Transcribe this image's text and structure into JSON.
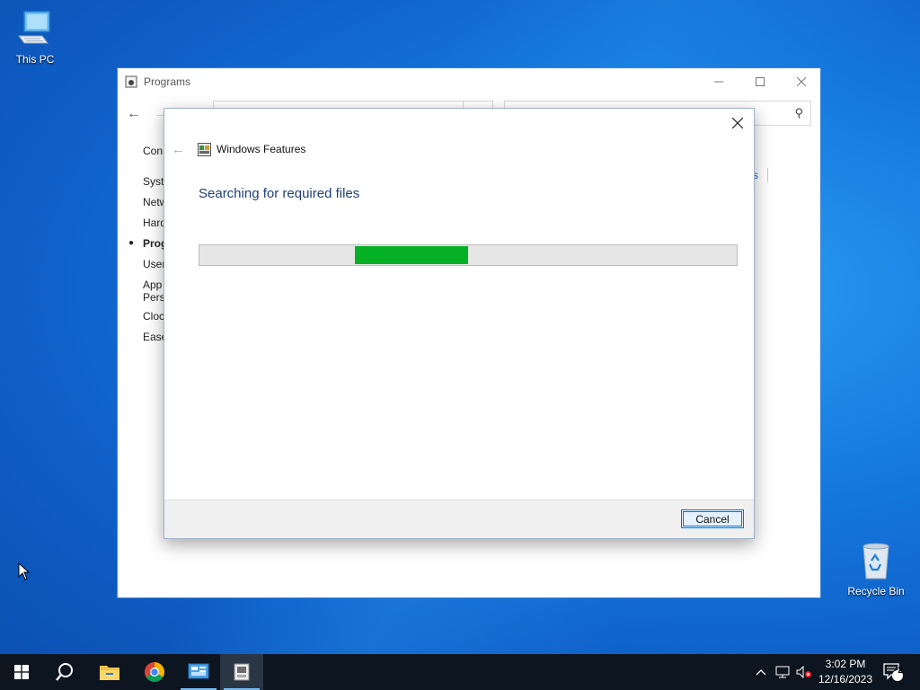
{
  "desktop": {
    "icons": [
      {
        "label": "This PC",
        "icon": "computer-icon"
      },
      {
        "label": "Recycle Bin",
        "icon": "recycle-bin-icon"
      }
    ]
  },
  "programs_window": {
    "title": "Programs",
    "sidebar_items": [
      "Con",
      "Syste",
      "Netw",
      "Hard",
      "Prog",
      "User",
      "App",
      "Pers",
      "Clock",
      "Ease"
    ],
    "active_item": "Prog",
    "link_fragment": "s"
  },
  "features_dialog": {
    "title": "Windows Features",
    "heading": "Searching for required files",
    "progress": {
      "style": "marquee",
      "segment_start_fraction": 0.29,
      "segment_width_fraction": 0.21,
      "color": "#06b025"
    },
    "cancel_label": "Cancel"
  },
  "taskbar": {
    "pinned": [
      "start-icon",
      "search-icon",
      "file-explorer-icon",
      "chrome-icon",
      "server-manager-icon",
      "windows-features-icon"
    ],
    "clock_time": "3:02 PM",
    "clock_date": "12/16/2023",
    "notification_count": "2"
  },
  "colors": {
    "accent": "#0078d7",
    "progress_green": "#06b025",
    "heading_blue": "#1e3f75",
    "taskbar": "#0d1520"
  }
}
